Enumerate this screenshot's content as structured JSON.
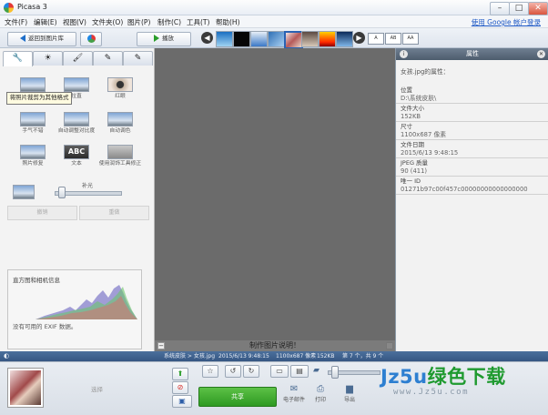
{
  "window": {
    "title": "Picasa 3",
    "minimize": "–",
    "maximize": "□",
    "close": "✕"
  },
  "menu": {
    "items": [
      "文件(F)",
      "编辑(E)",
      "视图(V)",
      "文件夹(O)",
      "图片(P)",
      "制作(C)",
      "工具(T)",
      "帮助(H)"
    ],
    "google_login": "使用 Google 帐户登录"
  },
  "toolbar": {
    "back_label": "返回到图片库",
    "play_label": "播放",
    "view_modes": [
      "A",
      "AB",
      "AA"
    ]
  },
  "tabs": [
    "🔧",
    "☀",
    "🖌",
    "✎",
    "✎"
  ],
  "tools": {
    "row1": [
      "裁剪",
      "拉直",
      "红眼"
    ],
    "row2": [
      "手气不错",
      "自动调整对比度",
      "自动调色"
    ],
    "row3": [
      "照片修复",
      "文本",
      "使用润饰工具修正"
    ],
    "tooltip": "将照片裁剪为其他格式",
    "fill_light_label": "补光",
    "undo_label": "撤销",
    "redo_label": "重做",
    "fill_light_level": 0.05
  },
  "histogram": {
    "title": "直方图和相机信息",
    "no_exif": "没有可用的 EXIF 数据。"
  },
  "caption": {
    "text": "制作图片说明！"
  },
  "properties": {
    "header": "属性",
    "intro": "女孩.jpg的属性：",
    "items": [
      {
        "k": "位置",
        "v": "D:\\系统皮肤\\"
      },
      {
        "k": "文件大小",
        "v": "152KB"
      },
      {
        "k": "尺寸",
        "v": "1100x687 像素"
      },
      {
        "k": "文件日期",
        "v": "2015/6/13 9:48:15"
      },
      {
        "k": "JPEG 质量",
        "v": "90 (411)"
      },
      {
        "k": "唯一 ID",
        "v": "01271b97c00f457c00000000000000000"
      }
    ]
  },
  "status": {
    "path": "系统皮肤 > 女孩.jpg",
    "date": "2015/6/13 9:48:15",
    "dims": "1100x687 像素",
    "size": "152KB",
    "counter": "第 7 个，共 9 个"
  },
  "tray": {
    "select_label": "选择",
    "share_label": "共享",
    "email_label": "电子邮件",
    "print_label": "打印",
    "export_label": "导出"
  },
  "watermark": {
    "big_latin": "Jz5u",
    "big_cn": "绿色下载",
    "small": "www.Jz5u.com"
  },
  "colors": {
    "share": "#3aa42e",
    "status_bar": "#3f5f8c",
    "center_bg": "#6b6b6b"
  }
}
